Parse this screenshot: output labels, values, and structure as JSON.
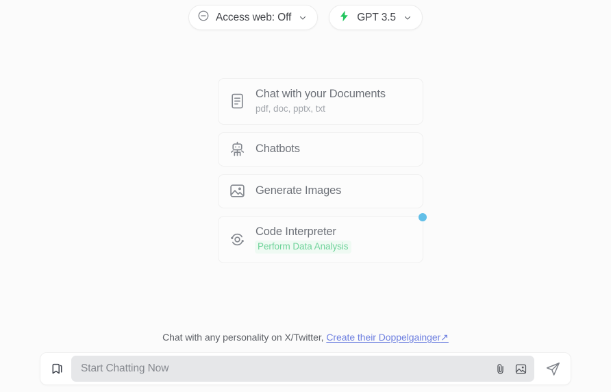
{
  "toolbar": {
    "web_access": {
      "label": "Access web: Off",
      "icon": "minus-circle-icon",
      "chevron": "chevron-down-icon"
    },
    "model": {
      "label": "GPT 3.5",
      "icon": "lightning-bolt-icon",
      "chevron": "chevron-down-icon",
      "accent_color": "#22c55e"
    }
  },
  "cards": [
    {
      "title": "Chat with your Documents",
      "subtitle": "pdf, doc, pptx, txt",
      "icon": "file-text-icon",
      "badge": false
    },
    {
      "title": "Chatbots",
      "subtitle": "",
      "icon": "robot-icon",
      "badge": false
    },
    {
      "title": "Generate Images",
      "subtitle": "",
      "icon": "image-icon",
      "badge": false
    },
    {
      "title": "Code Interpreter",
      "subtitle": "Perform Data Analysis",
      "icon": "orbit-icon",
      "badge": true,
      "badge_color": "#62bfe8",
      "subtitle_color": "#6fd39a"
    }
  ],
  "footer": {
    "text": "Chat with any personality on X/Twitter,",
    "link_label": "Create their Doppelgainger",
    "link_arrow": "↗",
    "link_color": "#6d7fe0"
  },
  "composer": {
    "bookmark_icon": "bookmark-icon",
    "placeholder": "Start Chatting Now",
    "value": "",
    "attach_icon": "paperclip-icon",
    "image_icon": "image-attach-icon",
    "send_icon": "send-icon"
  }
}
